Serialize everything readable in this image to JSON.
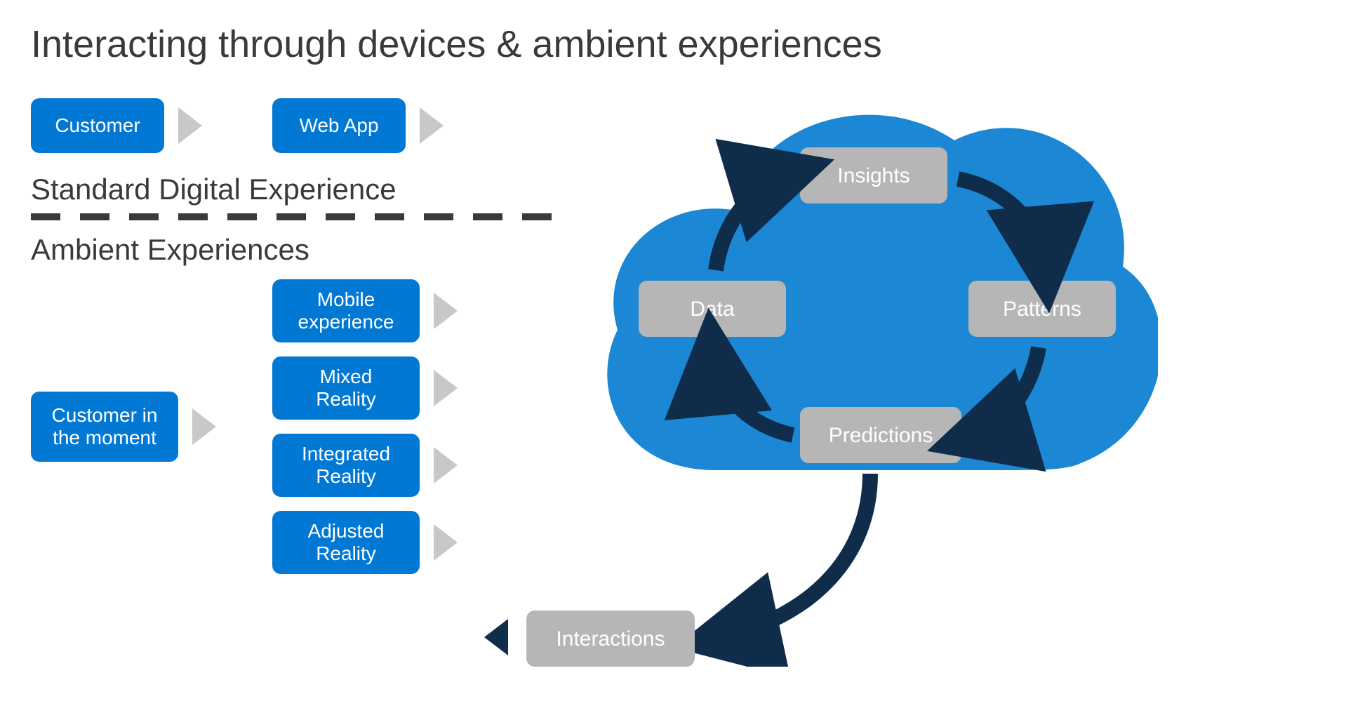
{
  "title": "Interacting through devices & ambient experiences",
  "standard": {
    "label": "Standard Digital Experience",
    "boxes": {
      "customer": "Customer",
      "webApp": "Web App"
    }
  },
  "ambient": {
    "label": "Ambient Experiences",
    "leftBox": "Customer in\nthe moment",
    "rightBoxes": {
      "mobile": "Mobile\nexperience",
      "mixed": "Mixed\nReality",
      "integrated": "Integrated\nReality",
      "adjusted": "Adjusted\nReality"
    }
  },
  "cloud": {
    "nodes": {
      "insights": "Insights",
      "patterns": "Patterns",
      "predictions": "Predictions",
      "data": "Data"
    },
    "output": "Interactions"
  },
  "colors": {
    "brandBlue": "#0078d4",
    "cloudBlue": "#1b87d5",
    "arrowDark": "#0f2d4a",
    "nodeGray": "#b6b6b6",
    "arrowGray": "#c8c8c8"
  }
}
